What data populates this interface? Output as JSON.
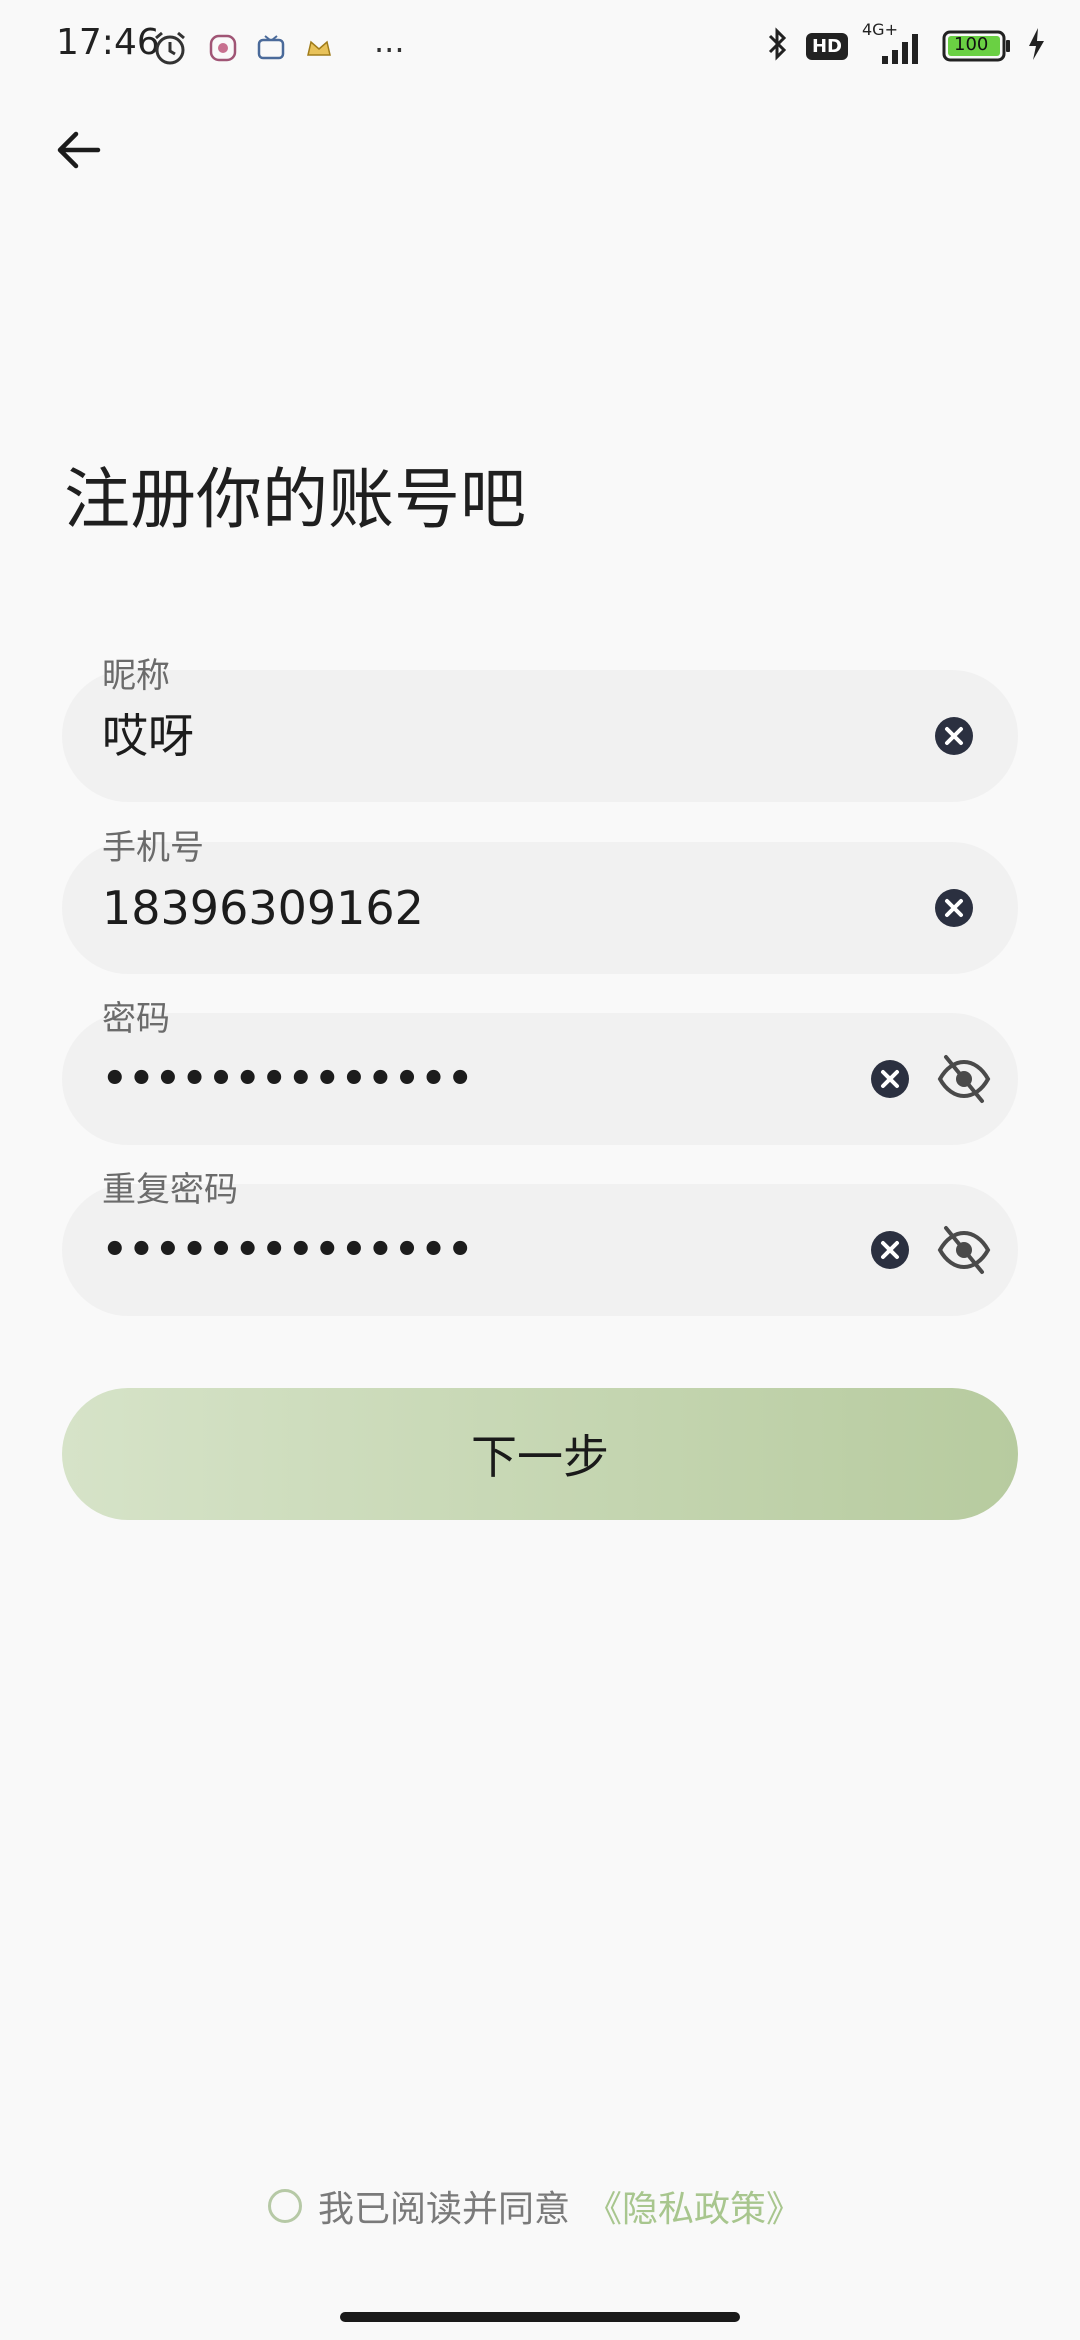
{
  "status_bar": {
    "time": "17:46",
    "battery": "100",
    "network": "4G+",
    "hd": "HD",
    "more": "···",
    "left_icons": [
      "alarm-icon",
      "app-icon-1",
      "app-icon-2",
      "crown-icon"
    ],
    "right_icons": [
      "bluetooth-icon",
      "hd-icon",
      "signal-icon",
      "battery-icon",
      "charging-icon"
    ]
  },
  "header": {
    "back_icon": "arrow-left-icon"
  },
  "title": "注册你的账号吧",
  "form": {
    "nickname": {
      "label": "昵称",
      "value": "哎呀"
    },
    "phone": {
      "label": "手机号",
      "value": "18396309162"
    },
    "password": {
      "label": "密码",
      "value": "••••••••••••••"
    },
    "confirm_password": {
      "label": "重复密码",
      "value": "••••••••••••••"
    }
  },
  "next_button": "下一步",
  "agreement": {
    "text": "我已阅读并同意",
    "link": "《隐私政策》",
    "checked": false
  },
  "colors": {
    "background": "#f9f9f9",
    "field": "#f1f1f1",
    "button_start": "#d6e3c8",
    "button_end": "#b7cb9f",
    "link": "#a8c68e",
    "clear_icon": "#2b3040"
  }
}
